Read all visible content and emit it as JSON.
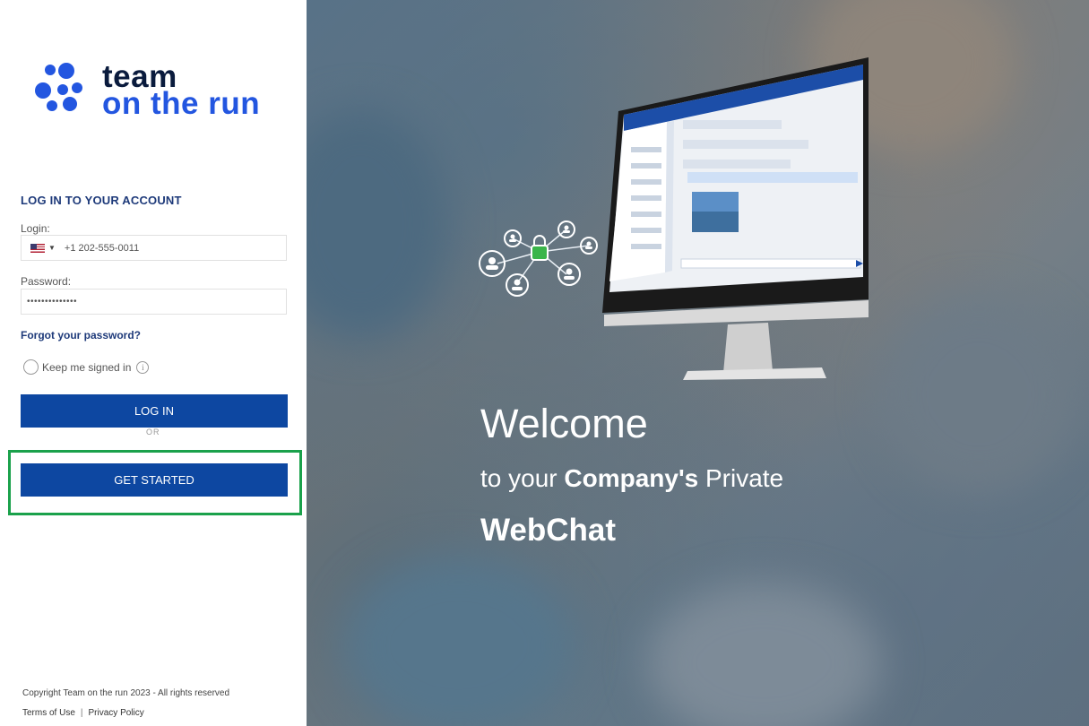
{
  "brand": {
    "name_line1": "team",
    "name_line2": "on the run",
    "dot_color": "#2356e0",
    "accent_dark": "#0a1b3d"
  },
  "login_form": {
    "heading": "LOG IN TO YOUR ACCOUNT",
    "login_label": "Login:",
    "country_flag": "us-flag-icon",
    "phone_value": "+1 202-555-0011",
    "password_label": "Password:",
    "password_value": "••••••••••••••",
    "forgot_link": "Forgot your password?",
    "keep_signed_in_label": "Keep me signed in",
    "info_glyph": "i",
    "login_button": "LOG IN",
    "or_divider": "OR",
    "get_started_button": "GET STARTED",
    "button_color": "#0d47a1",
    "highlight_color": "#1aa14b"
  },
  "footer": {
    "copyright": "Copyright Team on the run 2023 - All rights reserved",
    "terms_link": "Terms of Use",
    "separator": "|",
    "privacy_link": "Privacy Policy"
  },
  "hero": {
    "welcome": "Welcome",
    "tagline_prefix": "to your",
    "tagline_bold": "Company's",
    "tagline_suffix": "Private",
    "product": "WebChat"
  }
}
